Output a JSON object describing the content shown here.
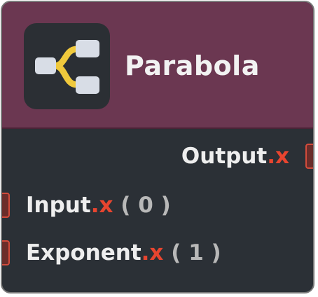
{
  "node": {
    "title": "Parabola",
    "icon": "branch-split-icon",
    "colors": {
      "header": "#6b3751",
      "body": "#2b3036",
      "component": "#e8452f",
      "port": "#d24b3b",
      "icon_branch": "#f0c93c",
      "icon_box": "#d8dde6"
    },
    "output": {
      "name": "Output",
      "component": ".x"
    },
    "inputs": [
      {
        "name": "Input",
        "component": ".x",
        "value": "( 0 )"
      },
      {
        "name": "Exponent",
        "component": ".x",
        "value": "( 1 )"
      }
    ]
  }
}
